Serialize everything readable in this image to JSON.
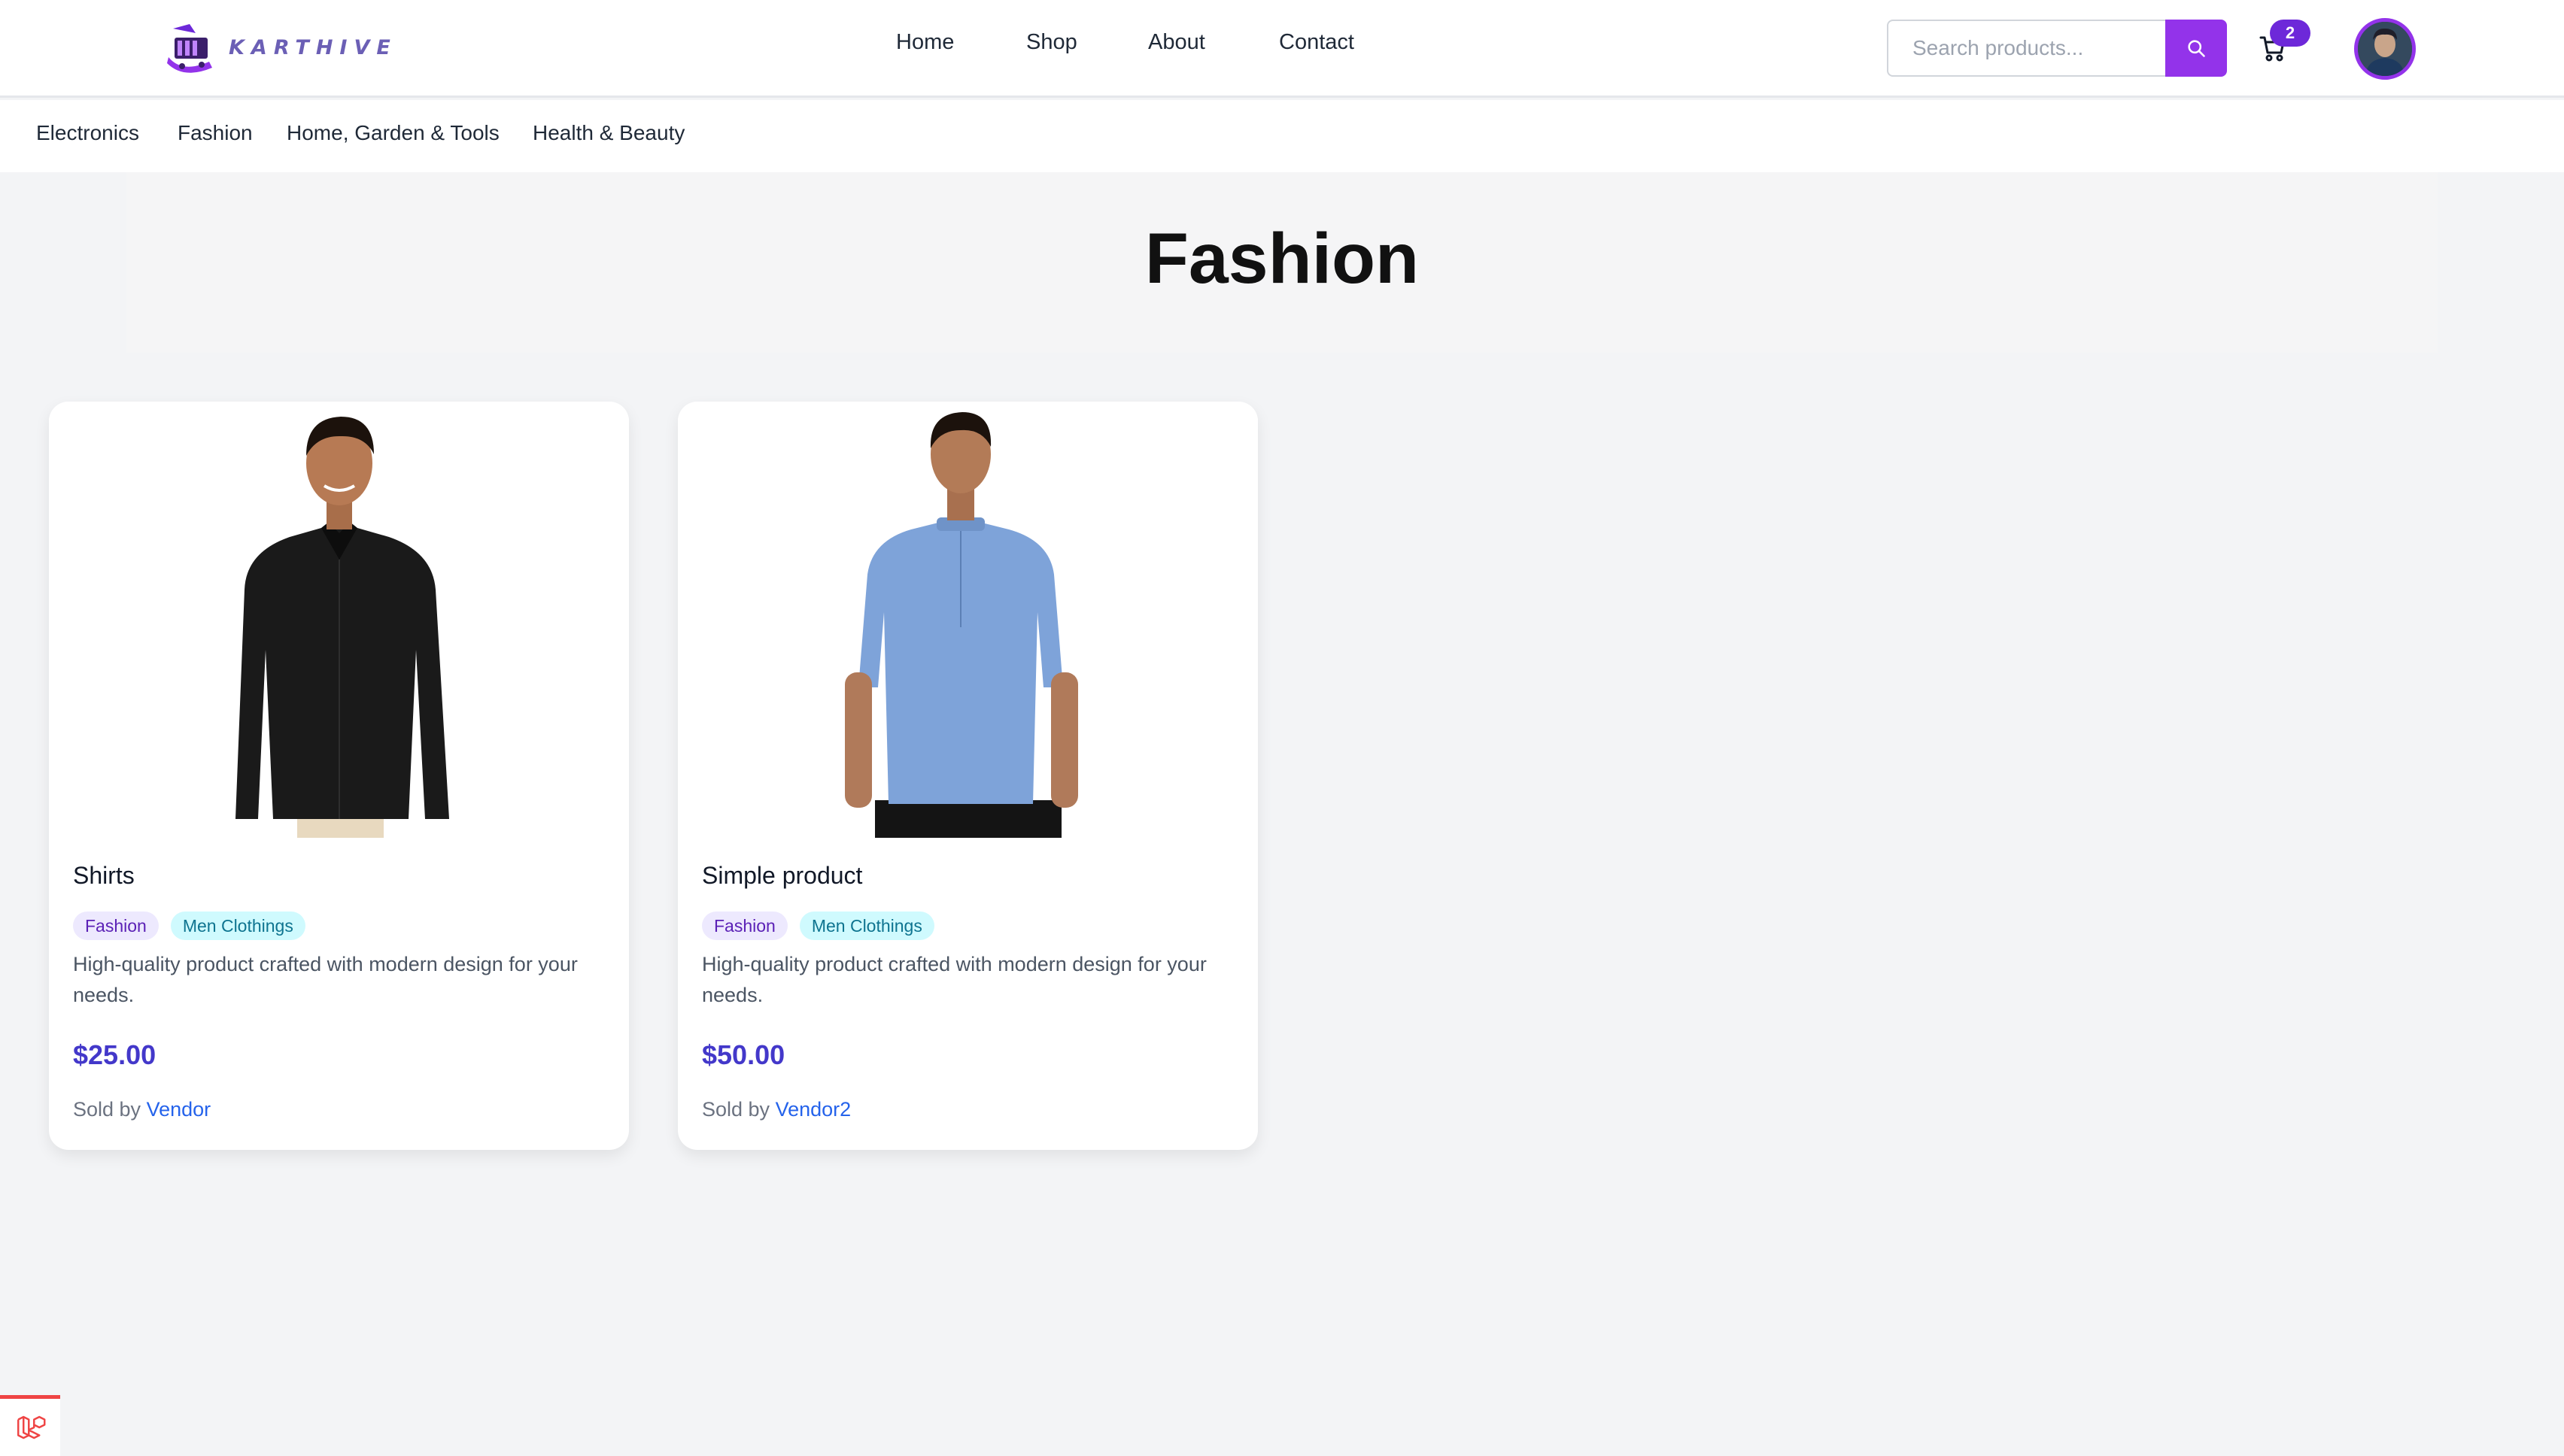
{
  "brand": {
    "name": "KARTHIVE"
  },
  "nav": {
    "items": [
      "Home",
      "Shop",
      "About",
      "Contact"
    ]
  },
  "search": {
    "placeholder": "Search products..."
  },
  "cart": {
    "count": "2"
  },
  "categories": [
    "Electronics",
    "Fashion",
    "Home, Garden & Tools",
    "Health & Beauty"
  ],
  "page": {
    "title": "Fashion"
  },
  "products": [
    {
      "title": "Shirts",
      "tags": [
        "Fashion",
        "Men Clothings"
      ],
      "description": "High-quality product crafted with modern design for your needs.",
      "price": "$25.00",
      "sold_by_label": "Sold by",
      "vendor": "Vendor",
      "shirt_color": "#1a1a1a"
    },
    {
      "title": "Simple product",
      "tags": [
        "Fashion",
        "Men Clothings"
      ],
      "description": "High-quality product crafted with modern design for your needs.",
      "price": "$50.00",
      "sold_by_label": "Sold by",
      "vendor": "Vendor2",
      "shirt_color": "#7ea3d9"
    }
  ],
  "colors": {
    "accent": "#9333ea",
    "price": "#4338ca",
    "link": "#2563eb",
    "badge": "#6d28d9"
  }
}
